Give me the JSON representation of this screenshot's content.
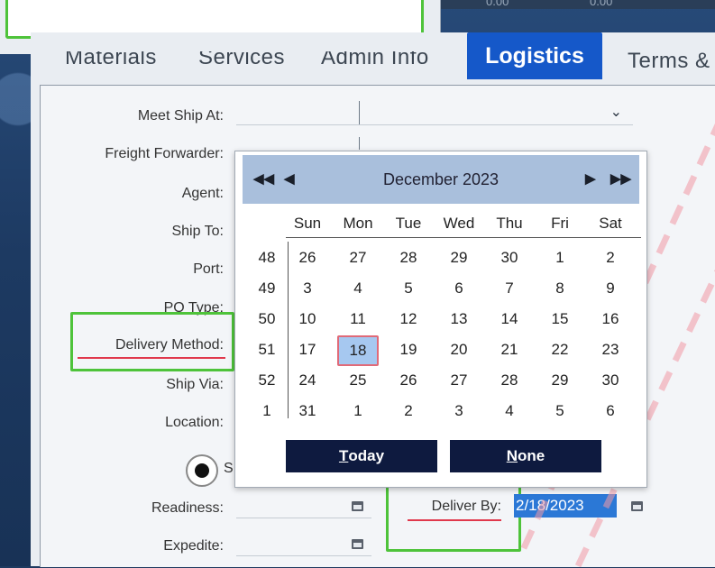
{
  "grid_values": [
    "0.00",
    "0.00"
  ],
  "tabs": [
    {
      "label": "Materials"
    },
    {
      "label": "Services"
    },
    {
      "label": "Admin Info"
    },
    {
      "label": "Logistics"
    },
    {
      "label": "Terms &"
    }
  ],
  "form": {
    "meet_ship_at": "Meet Ship At:",
    "freight_forwarder": "Freight Forwarder:",
    "agent": "Agent:",
    "ship_to": "Ship To:",
    "port": "Port:",
    "po_type": "PO Type:",
    "delivery_method": "Delivery Method:",
    "ship_via": "Ship Via:",
    "location": "Location:",
    "radio_label": "S",
    "readiness": "Readiness:",
    "expedite": "Expedite:",
    "deliver_by": "Deliver By:",
    "deliver_by_value": "2/18/2023"
  },
  "datepicker": {
    "month_year": "December 2023",
    "prev_year_icon": "double-left-arrow",
    "prev_month_icon": "left-arrow",
    "next_month_icon": "right-arrow",
    "next_year_icon": "double-right-arrow",
    "weekdays": [
      "Sun",
      "Mon",
      "Tue",
      "Wed",
      "Thu",
      "Fri",
      "Sat"
    ],
    "weeks": [
      {
        "num": "48",
        "days": [
          "26",
          "27",
          "28",
          "29",
          "30",
          "1",
          "2"
        ]
      },
      {
        "num": "49",
        "days": [
          "3",
          "4",
          "5",
          "6",
          "7",
          "8",
          "9"
        ]
      },
      {
        "num": "50",
        "days": [
          "10",
          "11",
          "12",
          "13",
          "14",
          "15",
          "16"
        ]
      },
      {
        "num": "51",
        "days": [
          "17",
          "18",
          "19",
          "20",
          "21",
          "22",
          "23"
        ]
      },
      {
        "num": "52",
        "days": [
          "24",
          "25",
          "26",
          "27",
          "28",
          "29",
          "30"
        ]
      },
      {
        "num": "1",
        "days": [
          "31",
          "1",
          "2",
          "3",
          "4",
          "5",
          "6"
        ]
      }
    ],
    "selected_day": "18",
    "today_label_first": "T",
    "today_label_rest": "oday",
    "none_label_first": "N",
    "none_label_rest": "one"
  },
  "colors": {
    "active_tab": "#1558c9",
    "highlight_green": "#4ec33a",
    "underline_red": "#e0384c",
    "datepicker_header": "#a9bfdc",
    "datepicker_buttons": "#0e1a3f",
    "selected_day": "#a6c8f0"
  }
}
